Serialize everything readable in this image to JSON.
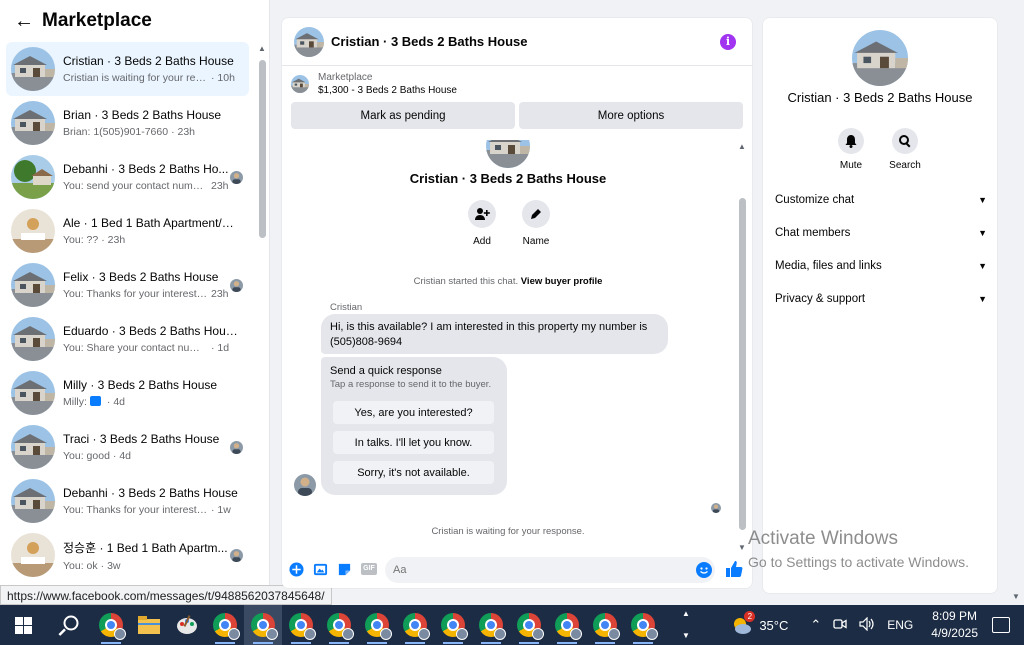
{
  "sidebar": {
    "title": "Marketplace",
    "conversations": [
      {
        "title": "Cristian · 3 Beds 2 Baths House",
        "snippet": "Cristian is waiting for your respo...",
        "time": "· 10h",
        "active": true,
        "thumb": "house"
      },
      {
        "title": "Brian · 3 Beds 2 Baths House",
        "snippet": "Brian: 1(505)901-7660",
        "time": "· 23h",
        "active": false,
        "thumb": "house"
      },
      {
        "title": "Debanhi · 3 Beds 2 Baths Ho...",
        "snippet": "You: send your contact numbe...",
        "time": "23h",
        "active": false,
        "thumb": "tree"
      },
      {
        "title": "Ale · 1 Bed 1 Bath Apartment/co...",
        "snippet": "You: ??",
        "time": "· 23h",
        "active": false,
        "thumb": "room"
      },
      {
        "title": "Felix · 3 Beds 2 Baths House",
        "snippet": "You: Thanks for your interest i...",
        "time": "23h",
        "active": false,
        "thumb": "house"
      },
      {
        "title": "Eduardo · 3 Beds 2 Baths House",
        "snippet": "You: Share your contact number a...",
        "time": "· 1d",
        "active": false,
        "thumb": "house"
      },
      {
        "title": "Milly · 3 Beds 2 Baths House",
        "snippet": "Milly:",
        "time": "· 4d",
        "active": false,
        "thumb": "house"
      },
      {
        "title": "Traci · 3 Beds 2 Baths House",
        "snippet": "You: good",
        "time": "· 4d",
        "active": false,
        "thumb": "house"
      },
      {
        "title": "Debanhi · 3 Beds 2 Baths House",
        "snippet": "You: Thanks for your interest in th...",
        "time": "· 1w",
        "active": false,
        "thumb": "house"
      },
      {
        "title": "정승훈 · 1 Bed 1 Bath Apartm...",
        "snippet": "You: ok",
        "time": "· 3w",
        "active": false,
        "thumb": "room"
      }
    ]
  },
  "status_url": "https://www.facebook.com/messages/t/9488562037845648/",
  "chat": {
    "header_name": "Cristian · 3 Beds 2 Baths House",
    "marketplace_label": "Marketplace",
    "listing": "$1,300 - 3 Beds 2 Baths House",
    "mark_pending": "Mark as pending",
    "more_options": "More options",
    "hero_name": "Cristian · 3 Beds 2 Baths House",
    "actions": {
      "add": "Add",
      "name": "Name"
    },
    "started_text": "Cristian started this chat.",
    "view_profile": "View buyer profile",
    "sender": "Cristian",
    "message": "Hi, is this available? I am interested in this property my number is (505)808-9694",
    "quick": {
      "title": "Send a quick response",
      "subtitle": "Tap a response to send it to the buyer.",
      "options": [
        "Yes, are you interested?",
        "In talks. I'll let you know.",
        "Sorry, it's not available."
      ]
    },
    "waiting": "Cristian is waiting for your response.",
    "input_placeholder": "Aa",
    "gif_label": "GIF"
  },
  "info_panel": {
    "name": "Cristian · 3 Beds 2 Baths House",
    "mute": "Mute",
    "search": "Search",
    "sections": [
      "Customize chat",
      "Chat members",
      "Media, files and links",
      "Privacy & support"
    ]
  },
  "watermark": {
    "line1": "Activate Windows",
    "line2": "Go to Settings to activate Windows."
  },
  "taskbar": {
    "weather_badge": "2",
    "temperature": "35°C",
    "language": "ENG",
    "time": "8:09 PM",
    "date": "4/9/2025"
  },
  "colors": {
    "accent": "#0a7cff",
    "info_purple": "#a034f0",
    "active_row": "#ebf5ff",
    "taskbar": "#1c2c44"
  }
}
